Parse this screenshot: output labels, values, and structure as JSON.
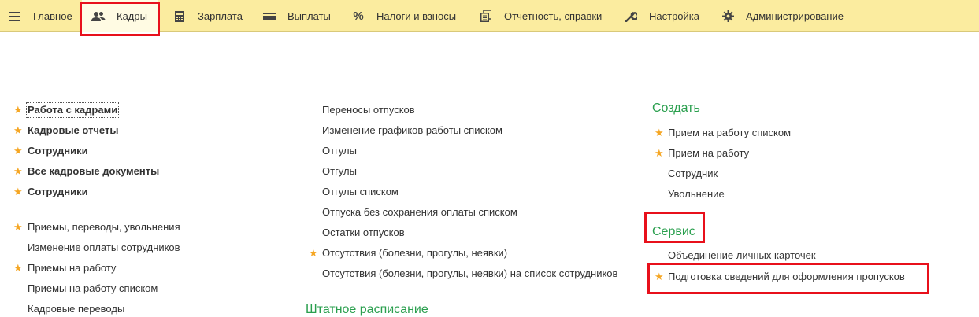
{
  "menu": {
    "main": "Главное",
    "hr": "Кадры",
    "salary": "Зарплата",
    "payments": "Выплаты",
    "taxes": "Налоги и взносы",
    "reports": "Отчетность, справки",
    "settings": "Настройка",
    "admin": "Администрирование"
  },
  "col1": {
    "group1": [
      {
        "label": "Работа с кадрами",
        "starred": true
      },
      {
        "label": "Кадровые отчеты",
        "starred": true
      },
      {
        "label": "Сотрудники",
        "starred": true
      },
      {
        "label": "Все кадровые документы",
        "starred": true
      },
      {
        "label": "Сотрудники",
        "starred": true
      }
    ],
    "group2": [
      {
        "label": "Приемы, переводы, увольнения",
        "starred": true
      },
      {
        "label": "Изменение оплаты сотрудников",
        "starred": false
      },
      {
        "label": "Приемы на работу",
        "starred": true
      },
      {
        "label": "Приемы на работу списком",
        "starred": false
      },
      {
        "label": "Кадровые переводы",
        "starred": false
      }
    ]
  },
  "col2": {
    "items": [
      {
        "label": "Переносы отпусков",
        "starred": false
      },
      {
        "label": "Изменение графиков работы списком",
        "starred": false
      },
      {
        "label": "Отгулы",
        "starred": false
      },
      {
        "label": "Отгулы",
        "starred": false
      },
      {
        "label": "Отгулы списком",
        "starred": false
      },
      {
        "label": "Отпуска без сохранения оплаты списком",
        "starred": false
      },
      {
        "label": "Остатки отпусков",
        "starred": false
      },
      {
        "label": "Отсутствия (болезни, прогулы, неявки)",
        "starred": true
      },
      {
        "label": "Отсутствия (болезни, прогулы, неявки) на список сотрудников",
        "starred": false
      }
    ],
    "section_title": "Штатное расписание"
  },
  "col3": {
    "create_title": "Создать",
    "create_items": [
      {
        "label": "Прием на работу списком",
        "starred": true
      },
      {
        "label": "Прием на работу",
        "starred": true
      },
      {
        "label": "Сотрудник",
        "starred": false
      },
      {
        "label": "Увольнение",
        "starred": false
      }
    ],
    "service_title": "Сервис",
    "service_items": [
      {
        "label": "Объединение личных карточек",
        "starred": false
      },
      {
        "label": "Подготовка сведений для оформления пропусков",
        "starred": true
      }
    ]
  },
  "colors": {
    "menu_bg": "#fbec9f",
    "section_green": "#2a9f4e",
    "star": "#f5a623",
    "highlight": "#e8101b"
  },
  "icons": {
    "main": "hamburger-icon",
    "hr": "users-icon",
    "salary": "calculator-icon",
    "payments": "wallet-icon",
    "taxes": "percent-icon",
    "reports": "documents-icon",
    "settings": "wrench-icon",
    "admin": "gear-icon",
    "favorite": "star-icon"
  }
}
